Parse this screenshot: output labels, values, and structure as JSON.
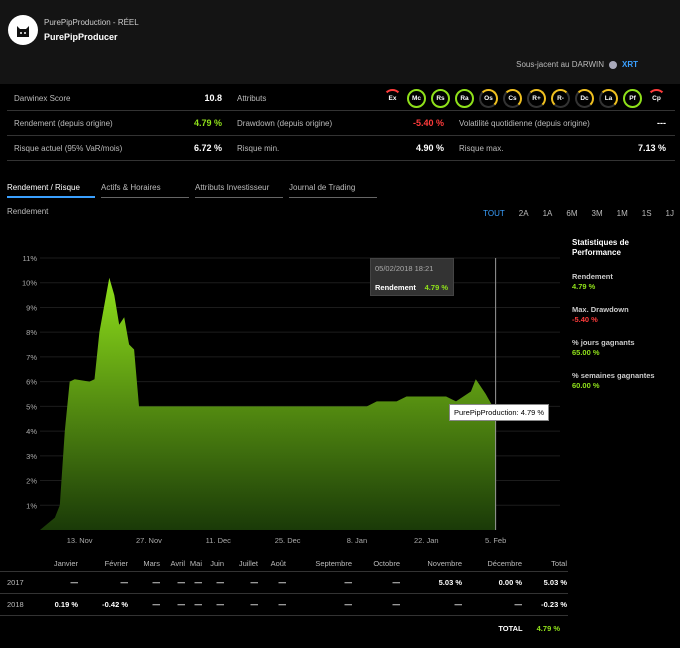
{
  "header": {
    "title": "PurePipProduction - RÉEL",
    "subtitle": "PurePipProducer",
    "underlying_label": "Sous-jacent au DARWIN",
    "underlying_value": "XRT"
  },
  "stats": {
    "score_label": "Darwinex Score",
    "score_value": "10.8",
    "attrs_label": "Attributs",
    "attributes": [
      "Ex",
      "Mc",
      "Rs",
      "Ra",
      "Os",
      "Cs",
      "R+",
      "R-",
      "Dc",
      "La",
      "Pf",
      "Cp"
    ],
    "return_label": "Rendement (depuis origine)",
    "return_value": "4.79 %",
    "drawdown_label": "Drawdown (depuis origine)",
    "drawdown_value": "-5.40 %",
    "volatility_label": "Volatilité quotidienne (depuis origine)",
    "volatility_value": "---",
    "risk_label": "Risque actuel (95% VaR/mois)",
    "risk_value": "6.72 %",
    "riskmin_label": "Risque min.",
    "riskmin_value": "4.90 %",
    "riskmax_label": "Risque max.",
    "riskmax_value": "7.13 %"
  },
  "tabs": [
    "Rendement / Risque",
    "Actifs & Horaires",
    "Attributs Investisseur",
    "Journal de Trading"
  ],
  "chart_section_label": "Rendement",
  "ranges": [
    "TOUT",
    "2A",
    "1A",
    "6M",
    "3M",
    "1M",
    "1S",
    "1J"
  ],
  "performance": {
    "title": "Statistiques de Performance",
    "items": [
      {
        "label": "Rendement",
        "value": "4.79 %",
        "color": "#8fe01a"
      },
      {
        "label": "Max. Drawdown",
        "value": "-5.40 %",
        "color": "#ff3b3b"
      },
      {
        "label": "% jours gagnants",
        "value": "65.00 %",
        "color": "#8fe01a"
      },
      {
        "label": "% semaines gagnantes",
        "value": "60.00 %",
        "color": "#8fe01a"
      }
    ]
  },
  "tooltip": {
    "date": "05/02/2018 18:21",
    "label": "Rendement",
    "value": "4.79 %",
    "pointer": "PurePipProduction: 4.79 %"
  },
  "chart_data": {
    "type": "area",
    "ylim": [
      0,
      11
    ],
    "yticks": [
      "11%",
      "10%",
      "9%",
      "8%",
      "7%",
      "6%",
      "5%",
      "4%",
      "3%",
      "2%",
      "1%"
    ],
    "xticks": [
      "13. Nov",
      "27. Nov",
      "11. Dec",
      "25. Dec",
      "8. Jan",
      "22. Jan",
      "5. Feb"
    ],
    "series": [
      {
        "values": [
          [
            "2017-11-05",
            0
          ],
          [
            "2017-11-08",
            0.5
          ],
          [
            "2017-11-09",
            1.0
          ],
          [
            "2017-11-10",
            4.0
          ],
          [
            "2017-11-11",
            6.0
          ],
          [
            "2017-11-12",
            6.1
          ],
          [
            "2017-11-15",
            6.0
          ],
          [
            "2017-11-16",
            6.1
          ],
          [
            "2017-11-17",
            8.0
          ],
          [
            "2017-11-19",
            10.2
          ],
          [
            "2017-11-20",
            9.5
          ],
          [
            "2017-11-21",
            8.3
          ],
          [
            "2017-11-22",
            8.6
          ],
          [
            "2017-11-23",
            7.5
          ],
          [
            "2017-11-24",
            7.3
          ],
          [
            "2017-11-25",
            5.0
          ],
          [
            "2018-01-10",
            5.0
          ],
          [
            "2018-01-12",
            5.2
          ],
          [
            "2018-01-16",
            5.2
          ],
          [
            "2018-01-18",
            5.4
          ],
          [
            "2018-01-22",
            5.4
          ],
          [
            "2018-01-26",
            5.4
          ],
          [
            "2018-01-28",
            5.2
          ],
          [
            "2018-01-31",
            5.6
          ],
          [
            "2018-02-01",
            6.1
          ],
          [
            "2018-02-03",
            5.5
          ],
          [
            "2018-02-05",
            4.79
          ]
        ]
      }
    ]
  },
  "months_table": {
    "headers": [
      "Janvier",
      "Février",
      "Mars",
      "Avril",
      "Mai",
      "Juin",
      "Juillet",
      "Août",
      "Septembre",
      "Octobre",
      "Novembre",
      "Décembre",
      "Total"
    ],
    "rows": [
      {
        "year": "2017",
        "cells": [
          "—",
          "—",
          "—",
          "—",
          "—",
          "—",
          "—",
          "—",
          "—",
          "—",
          "5.03 %",
          "0.00 %",
          "5.03 %"
        ]
      },
      {
        "year": "2018",
        "cells": [
          "0.19 %",
          "-0.42 %",
          "—",
          "—",
          "—",
          "—",
          "—",
          "—",
          "—",
          "—",
          "—",
          "—",
          "-0.23 %"
        ]
      }
    ],
    "total_label": "TOTAL",
    "total_value": "4.79 %"
  }
}
